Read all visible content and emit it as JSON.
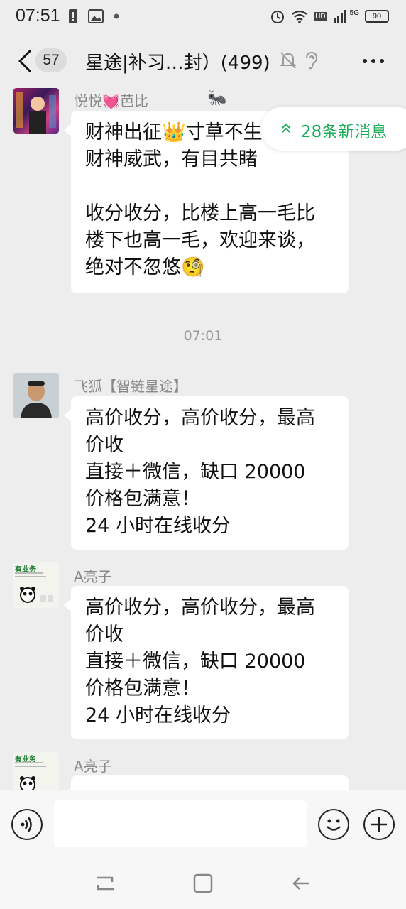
{
  "status_bar": {
    "time": "07:51",
    "network_label": "5G",
    "hd_label": "HD",
    "battery": "90"
  },
  "header": {
    "unread_count": "57",
    "title": "星途|补习…封）(499)"
  },
  "new_messages_label": "28条新消息",
  "messages": [
    {
      "sender": "悦悦💓芭比",
      "lines": [
        "财神出征👑寸草不生",
        "财神威武，有目共睹",
        "",
        "收分收分，比楼上高一毛比",
        "楼下也高一毛，欢迎来谈，",
        "绝对不忽悠🧐"
      ]
    },
    {
      "timestamp": "07:01"
    },
    {
      "sender": "飞狐【智链星途】",
      "lines": [
        "高价收分，高价收分，最高",
        "价收",
        "直接＋微信，缺口 20000",
        "价格包满意！",
        "24 小时在线收分"
      ]
    },
    {
      "sender": "A亮子",
      "avatar_text": "有业务",
      "lines": [
        "高价收分，高价收分，最高",
        "价收",
        "直接＋微信，缺口 20000",
        "价格包满意！",
        "24 小时在线收分"
      ]
    },
    {
      "sender": "A亮子",
      "avatar_text": "有业务",
      "lines": []
    }
  ],
  "input": {
    "value": "",
    "placeholder": ""
  },
  "colors": {
    "accent": "#1aad58",
    "background": "#ededed",
    "bubble": "#ffffff"
  }
}
